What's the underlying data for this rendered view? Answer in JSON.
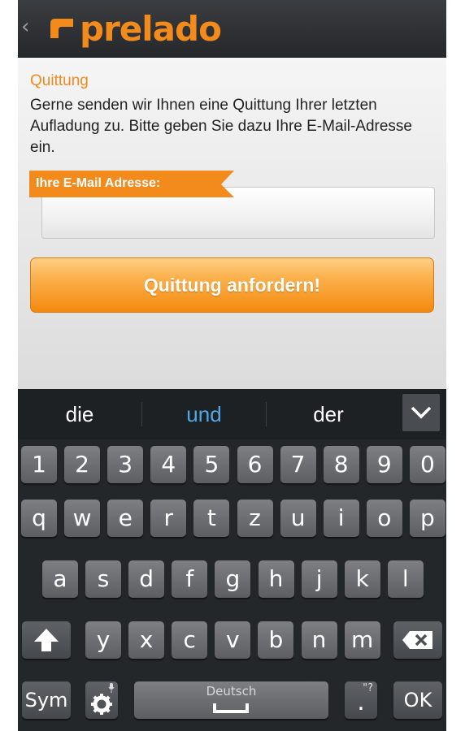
{
  "app": {
    "brand": "prelado",
    "back_glyph": "‹",
    "brand_color": "#f28a1c"
  },
  "receipt": {
    "title": "Quittung",
    "description": "Gerne senden wir Ihnen eine Quittung Ihrer letzten Aufladung zu. Bitte geben Sie dazu Ihre E-Mail-Adresse ein.",
    "email_label": "Ihre E-Mail Adresse:",
    "email_value": "",
    "email_placeholder": "",
    "submit_label": "Quittung anfordern!"
  },
  "keyboard": {
    "suggestions": [
      "die",
      "und",
      "der"
    ],
    "highlight_color": "#4ea9e8",
    "number_row": [
      "1",
      "2",
      "3",
      "4",
      "5",
      "6",
      "7",
      "8",
      "9",
      "0"
    ],
    "row1": [
      "q",
      "w",
      "e",
      "r",
      "t",
      "z",
      "u",
      "i",
      "o",
      "p"
    ],
    "row2": [
      "a",
      "s",
      "d",
      "f",
      "g",
      "h",
      "j",
      "k",
      "l"
    ],
    "row3": [
      "y",
      "x",
      "c",
      "v",
      "b",
      "n",
      "m"
    ],
    "sym_label": "Sym",
    "space_label": "Deutsch",
    "dot_label": ".",
    "dot_hint": "\"?",
    "ok_label": "OK",
    "icons": {
      "shift": "shift-icon",
      "backspace": "backspace-icon",
      "settings": "gear-icon",
      "mic": "mic-icon",
      "collapse": "chevron-down-icon"
    }
  }
}
